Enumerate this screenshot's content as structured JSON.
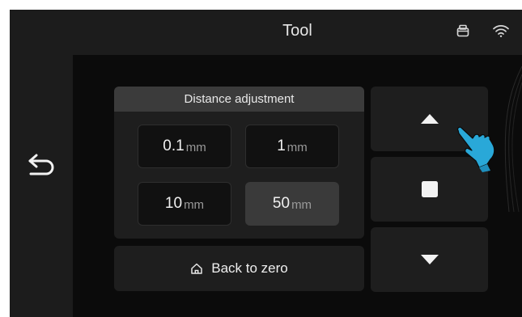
{
  "header": {
    "title": "Tool"
  },
  "distance": {
    "title": "Distance adjustment",
    "options": [
      {
        "value": "0.1",
        "unit": "mm"
      },
      {
        "value": "1",
        "unit": "mm"
      },
      {
        "value": "10",
        "unit": "mm"
      },
      {
        "value": "50",
        "unit": "mm"
      }
    ],
    "selected": "50"
  },
  "back_to_zero": {
    "label": "Back to zero"
  },
  "icons": {
    "back": "back-arrow-icon",
    "printer": "printer-icon",
    "wifi": "wifi-icon",
    "home": "home-icon",
    "up": "triangle-up-icon",
    "stop": "square-stop-icon",
    "down": "triangle-down-icon",
    "hand": "pointing-hand-icon"
  },
  "colors": {
    "accent_hand": "#29a8d8",
    "panel_bg": "#1e1e1e",
    "screen_bg": "#0b0b0b"
  }
}
